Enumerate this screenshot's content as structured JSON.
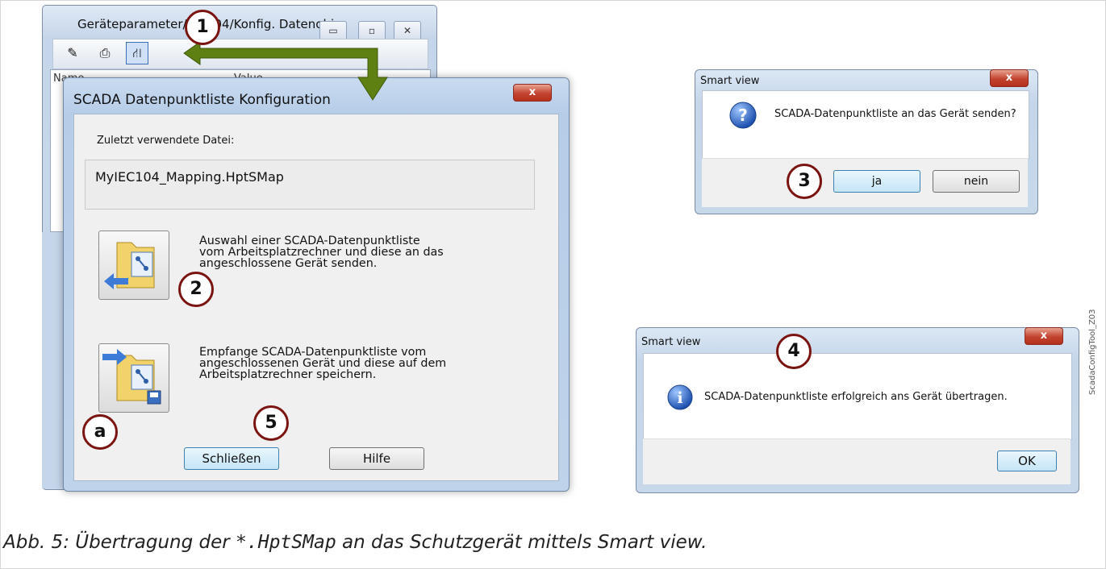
{
  "bg_window": {
    "title": "Geräteparameter/IEC104/Konfig. Datenobj.",
    "columns": [
      "Name",
      "Value"
    ],
    "caption_buttons": [
      "minimize",
      "maximize",
      "close"
    ]
  },
  "main_dialog": {
    "title": "SCADA Datenpunktliste Konfiguration",
    "close_glyph": "x",
    "last_file_label": "Zuletzt verwendete Datei:",
    "last_file_value": "MyIEC104_Mapping.HptSMap",
    "send_desc": [
      "Auswahl einer SCADA-Datenpunktliste",
      "vom Arbeitsplatzrechner und diese an das",
      "angeschlossene Gerät senden."
    ],
    "receive_desc": [
      "Empfange SCADA-Datenpunktliste vom",
      "angeschlossenen Gerät und diese auf dem",
      "Arbeitsplatzrechner speichern."
    ],
    "close_button": "Schließen",
    "help_button": "Hilfe"
  },
  "confirm_dialog": {
    "title": "Smart view",
    "close_glyph": "x",
    "icon": "question-icon",
    "message": "SCADA-Datenpunktliste an das Gerät senden?",
    "yes_button": "ja",
    "no_button": "nein"
  },
  "info_dialog": {
    "title": "Smart view",
    "close_glyph": "x",
    "icon": "info-icon",
    "message": "SCADA-Datenpunktliste erfolgreich ans Gerät übertragen.",
    "ok_button": "OK"
  },
  "markers": {
    "m1": "1",
    "m2": "2",
    "m3": "3",
    "m4": "4",
    "m5": "5",
    "ma": "a"
  },
  "side_label": "ScadaConfigTool_Z03",
  "caption": {
    "prefix": "Abb. 5: Übertragung der ",
    "code": "*.HptSMap",
    "suffix": " an das Schutzgerät mittels Smart view."
  },
  "colors": {
    "marker_border": "#7a1410",
    "arrow_green": "#5e7f12",
    "close_red": "#c2432f"
  }
}
